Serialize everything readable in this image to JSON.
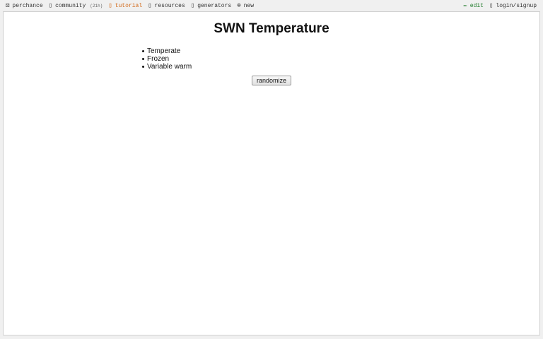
{
  "topbar": {
    "brand": {
      "icon": "dice-icon",
      "label": "perchance"
    },
    "community": {
      "icon": "chat-icon",
      "label": "community",
      "count": "(21h)"
    },
    "tutorial": {
      "icon": "book-icon",
      "label": "tutorial",
      "color": "#d26a1a"
    },
    "resources": {
      "icon": "resources-icon",
      "label": "resources"
    },
    "generators": {
      "icon": "generators-icon",
      "label": "generators"
    },
    "new": {
      "icon": "plus-circle-icon",
      "label": "new"
    },
    "edit": {
      "icon": "pencil-icon",
      "label": "edit",
      "color": "#1f7a2a"
    },
    "login": {
      "icon": "user-icon",
      "label": "login/signup"
    }
  },
  "main": {
    "title": "SWN Temperature",
    "results": [
      "Temperate",
      "Frozen",
      "Variable warm"
    ],
    "randomize_label": "randomize"
  }
}
